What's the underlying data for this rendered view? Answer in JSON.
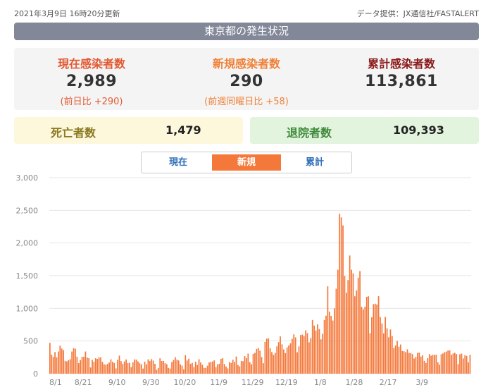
{
  "header": {
    "updated": "2021年3月9日 16時20分更新",
    "source": "データ提供：JX通信社/FASTALERT",
    "banner": "東京都の発生状況"
  },
  "stats": {
    "current": {
      "label": "現在感染者数",
      "value": "2,989",
      "sub": "(前日比 +290)"
    },
    "new": {
      "label": "新規感染者数",
      "value": "290",
      "sub": "(前週同曜日比 +58)"
    },
    "total": {
      "label": "累計感染者数",
      "value": "113,861"
    }
  },
  "deaths": {
    "label": "死亡者数",
    "value": "1,479"
  },
  "recovered": {
    "label": "退院者数",
    "value": "109,393"
  },
  "tabs": [
    {
      "label": "現在",
      "active": false
    },
    {
      "label": "新規",
      "active": true
    },
    {
      "label": "累計",
      "active": false
    }
  ],
  "colors": {
    "current_label": "#e15a33",
    "new_label": "#f0823a",
    "total_label": "#8b1a1a",
    "deaths_bg": "#fdf7dc",
    "deaths_label": "#8a7a22",
    "recovered_bg": "#e2f3de",
    "recovered_label": "#3e8a3a",
    "bar": "#f4783a",
    "tab_active_bg": "#f4783a",
    "tab_text": "#2f6fba"
  },
  "chart_data": {
    "type": "bar",
    "ylim": [
      0,
      3000
    ],
    "yticks": [
      "0",
      "500",
      "1,000",
      "1,500",
      "2,000",
      "2,500",
      "3,000"
    ],
    "xticks": [
      "8/1",
      "8/21",
      "9/10",
      "9/30",
      "10/20",
      "11/9",
      "11/29",
      "12/19",
      "1/8",
      "1/28",
      "2/17",
      "3/9"
    ],
    "grid": true,
    "start_label": "8/1",
    "values": [
      472,
      292,
      258,
      331,
      250,
      339,
      429,
      385,
      360,
      197,
      188,
      207,
      222,
      339,
      389,
      382,
      260,
      161,
      207,
      258,
      258,
      339,
      247,
      237,
      95,
      212,
      182,
      236,
      226,
      250,
      250,
      181,
      143,
      136,
      150,
      170,
      220,
      181,
      163,
      80,
      212,
      276,
      191,
      151,
      187,
      218,
      162,
      166,
      100,
      173,
      218,
      215,
      188,
      160,
      144,
      78,
      183,
      143,
      220,
      193,
      222,
      200,
      151,
      59,
      88,
      235,
      194,
      196,
      161,
      145,
      88,
      78,
      178,
      211,
      252,
      214,
      203,
      142,
      123,
      67,
      284,
      202,
      230,
      150,
      165,
      102,
      182,
      133,
      221,
      172,
      136,
      89,
      90,
      122,
      171,
      180,
      185,
      203,
      102,
      143,
      152,
      228,
      237,
      147,
      109,
      80,
      178,
      163,
      214,
      181,
      263,
      133,
      112,
      195,
      190,
      270,
      239,
      307,
      176,
      144,
      303,
      317,
      379,
      392,
      352,
      254,
      160,
      486,
      536,
      539,
      388,
      331,
      288,
      318,
      418,
      482,
      570,
      449,
      372,
      314,
      402,
      432,
      464,
      533,
      602,
      556,
      327,
      418,
      592,
      599,
      576,
      664,
      621,
      480,
      546,
      822,
      736,
      660,
      755,
      683,
      526,
      610,
      821,
      888,
      1337,
      949,
      884,
      813,
      1000,
      1300,
      1591,
      2447,
      2392,
      2268,
      1494,
      1239,
      1433,
      1809,
      1591,
      1536,
      1184,
      1275,
      1470,
      1571,
      1023,
      983,
      1026,
      1176,
      1184,
      619,
      863,
      1064,
      1071,
      1059,
      1186,
      866,
      769,
      618,
      868,
      694,
      557,
      676,
      577,
      393,
      431,
      499,
      413,
      447,
      348,
      343,
      329,
      373,
      317,
      315,
      300,
      232,
      255,
      318,
      323,
      262,
      281,
      196,
      163,
      237,
      300,
      275,
      289,
      287,
      291,
      174,
      137,
      298,
      310,
      329,
      338,
      355,
      356,
      288,
      309,
      320,
      300,
      145,
      297,
      307,
      232,
      282,
      272,
      175,
      290
    ]
  }
}
